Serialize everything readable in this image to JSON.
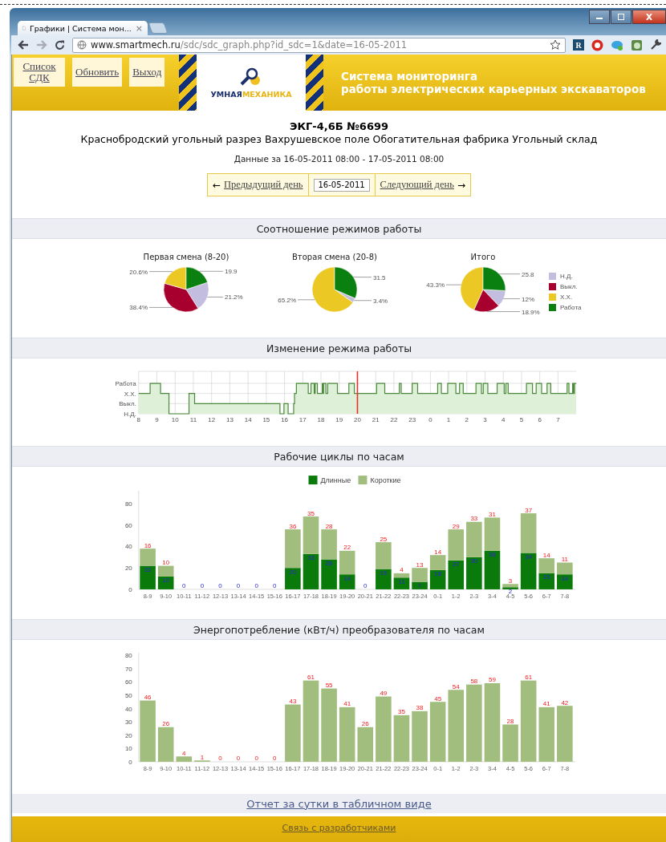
{
  "browser": {
    "tab": {
      "title": "Графики | Система мон...",
      "close": "×"
    },
    "url": {
      "host": "www.smartmech.ru",
      "path": "/sdc/sdc_graph.php?id_sdc=1&date=16-05-2011"
    },
    "extension_badge": "R"
  },
  "header": {
    "nav": [
      "Список СДК",
      "Обновить",
      "Выход"
    ],
    "logo": {
      "part1": "УМНАЯ",
      "part2": "МЕХАНИКА"
    },
    "title_lines": [
      "Система мониторинга",
      "работы электрических карьерных экскаваторов"
    ]
  },
  "machine": {
    "name": "ЭКГ-4,6Б №6699",
    "location": "Краснобродский угольный разрез Вахрушевское поле Обогатительная фабрика Угольный склад",
    "period": "Данные за 16-05-2011 08:00 - 17-05-2011 08:00"
  },
  "day_nav": {
    "prev_arrow": "←",
    "prev": "Предыдущий день",
    "date": "16-05-2011",
    "next": "Следующий день",
    "next_arrow": "→"
  },
  "mode_ratio": {
    "title": "Соотношение режимов работы",
    "pies": [
      {
        "chart_data": {
          "type": "pie",
          "title": "Первая смена (8-20)",
          "colors": [
            "#c3bee0",
            "#a8002e",
            "#ebc824",
            "#0a8010"
          ],
          "values": [
            21.2,
            38.4,
            20.6,
            19.9
          ],
          "value_labels": [
            "21.2%",
            "38.4%",
            "20.6%",
            "19.9"
          ]
        }
      },
      {
        "chart_data": {
          "type": "pie",
          "title": "Вторая смена (20-8)",
          "colors": [
            "#c3bee0",
            "#ebc824",
            "#0a8010"
          ],
          "values": [
            3.4,
            65.2,
            31.5
          ],
          "value_labels": [
            "3.4%",
            "65.2%",
            "31.5"
          ]
        }
      },
      {
        "chart_data": {
          "type": "pie",
          "title": "Итого",
          "categories": [
            "Н.Д.",
            "Выкл.",
            "Х.Х.",
            "Работа"
          ],
          "colors": [
            "#c3bee0",
            "#a8002e",
            "#ebc824",
            "#0a8010"
          ],
          "values": [
            12,
            18.9,
            43.3,
            25.8
          ],
          "value_labels": [
            "12%",
            "18.9%",
            "43.3%",
            "25.8"
          ],
          "legend": "right"
        }
      }
    ]
  },
  "mode_change": {
    "title": "Изменение режима работы",
    "y_labels": [
      "Работа",
      "Х.Х.",
      "Выкл.",
      "Н.Д."
    ],
    "x_labels": [
      "8",
      "9",
      "10",
      "11",
      "12",
      "13",
      "14",
      "15",
      "16",
      "17",
      "18",
      "19",
      "20",
      "21",
      "22",
      "23",
      "0",
      "1",
      "2",
      "3",
      "4",
      "5",
      "6",
      "7"
    ]
  },
  "cycles": {
    "title": "Рабочие циклы по часам",
    "chart_data": {
      "type": "bar",
      "stacked": true,
      "legend": "top",
      "ylim": [
        0,
        92
      ],
      "yticks": [
        0,
        20,
        40,
        60,
        80
      ],
      "categories": [
        "8-9",
        "9-10",
        "10-11",
        "11-12",
        "12-13",
        "13-14",
        "14-15",
        "15-16",
        "16-17",
        "17-18",
        "18-19",
        "19-20",
        "20-21",
        "21-22",
        "22-23",
        "23-24",
        "0-1",
        "1-2",
        "2-3",
        "3-4",
        "4-5",
        "5-6",
        "6-7",
        "7-8"
      ],
      "series": [
        {
          "name": "Длинные",
          "color": "#0a7a0a",
          "values": [
            22,
            12,
            0,
            0,
            0,
            0,
            0,
            0,
            20,
            33,
            28,
            14,
            0,
            19,
            11,
            7,
            18,
            27,
            30,
            36,
            2,
            34,
            15,
            14
          ],
          "value_labels": [
            "22",
            "12",
            "0",
            "0",
            "0",
            "0",
            "0",
            "0",
            "20",
            "33",
            "28",
            "14",
            "0",
            "19",
            "11",
            "7",
            "18",
            "27",
            "30",
            "36",
            "2",
            "34",
            "15",
            "14"
          ]
        },
        {
          "name": "Короткие",
          "color": "#a2be7e",
          "values": [
            16,
            10,
            0,
            0,
            0,
            0,
            0,
            0,
            36,
            35,
            28,
            22,
            0,
            25,
            4,
            13,
            14,
            29,
            33,
            31,
            3,
            37,
            14,
            11
          ],
          "value_labels": [
            "16",
            "10",
            null,
            null,
            null,
            null,
            null,
            null,
            "36",
            "35",
            "28",
            "22",
            null,
            "25",
            "4",
            "13",
            "14",
            "29",
            "33",
            "31",
            "3",
            "37",
            "14",
            "11"
          ]
        }
      ]
    }
  },
  "energy": {
    "title": "Энергопотребление (кВт/ч) преобразователя по часам",
    "chart_data": {
      "type": "bar",
      "data_labels": true,
      "ylim": [
        0,
        82
      ],
      "yticks": [
        0,
        10,
        20,
        30,
        40,
        50,
        60,
        70,
        80
      ],
      "categories": [
        "8-9",
        "9-10",
        "10-11",
        "11-12",
        "12-13",
        "13-14",
        "14-15",
        "15-16",
        "16-17",
        "17-18",
        "18-19",
        "19-20",
        "20-21",
        "21-22",
        "22-23",
        "23-24",
        "0-1",
        "1-2",
        "2-3",
        "3-4",
        "4-5",
        "5-6",
        "6-7",
        "7-8"
      ],
      "series": [
        {
          "color": "#a2be7e",
          "values": [
            46,
            26,
            4,
            1,
            0,
            0,
            0,
            0,
            43,
            61,
            55,
            41,
            26,
            49,
            35,
            38,
            45,
            54,
            58,
            59,
            28,
            61,
            41,
            42
          ]
        }
      ]
    }
  },
  "report_link": "Отчет за сутки в табличном виде",
  "footer_link": "Связь с разработчиками"
}
